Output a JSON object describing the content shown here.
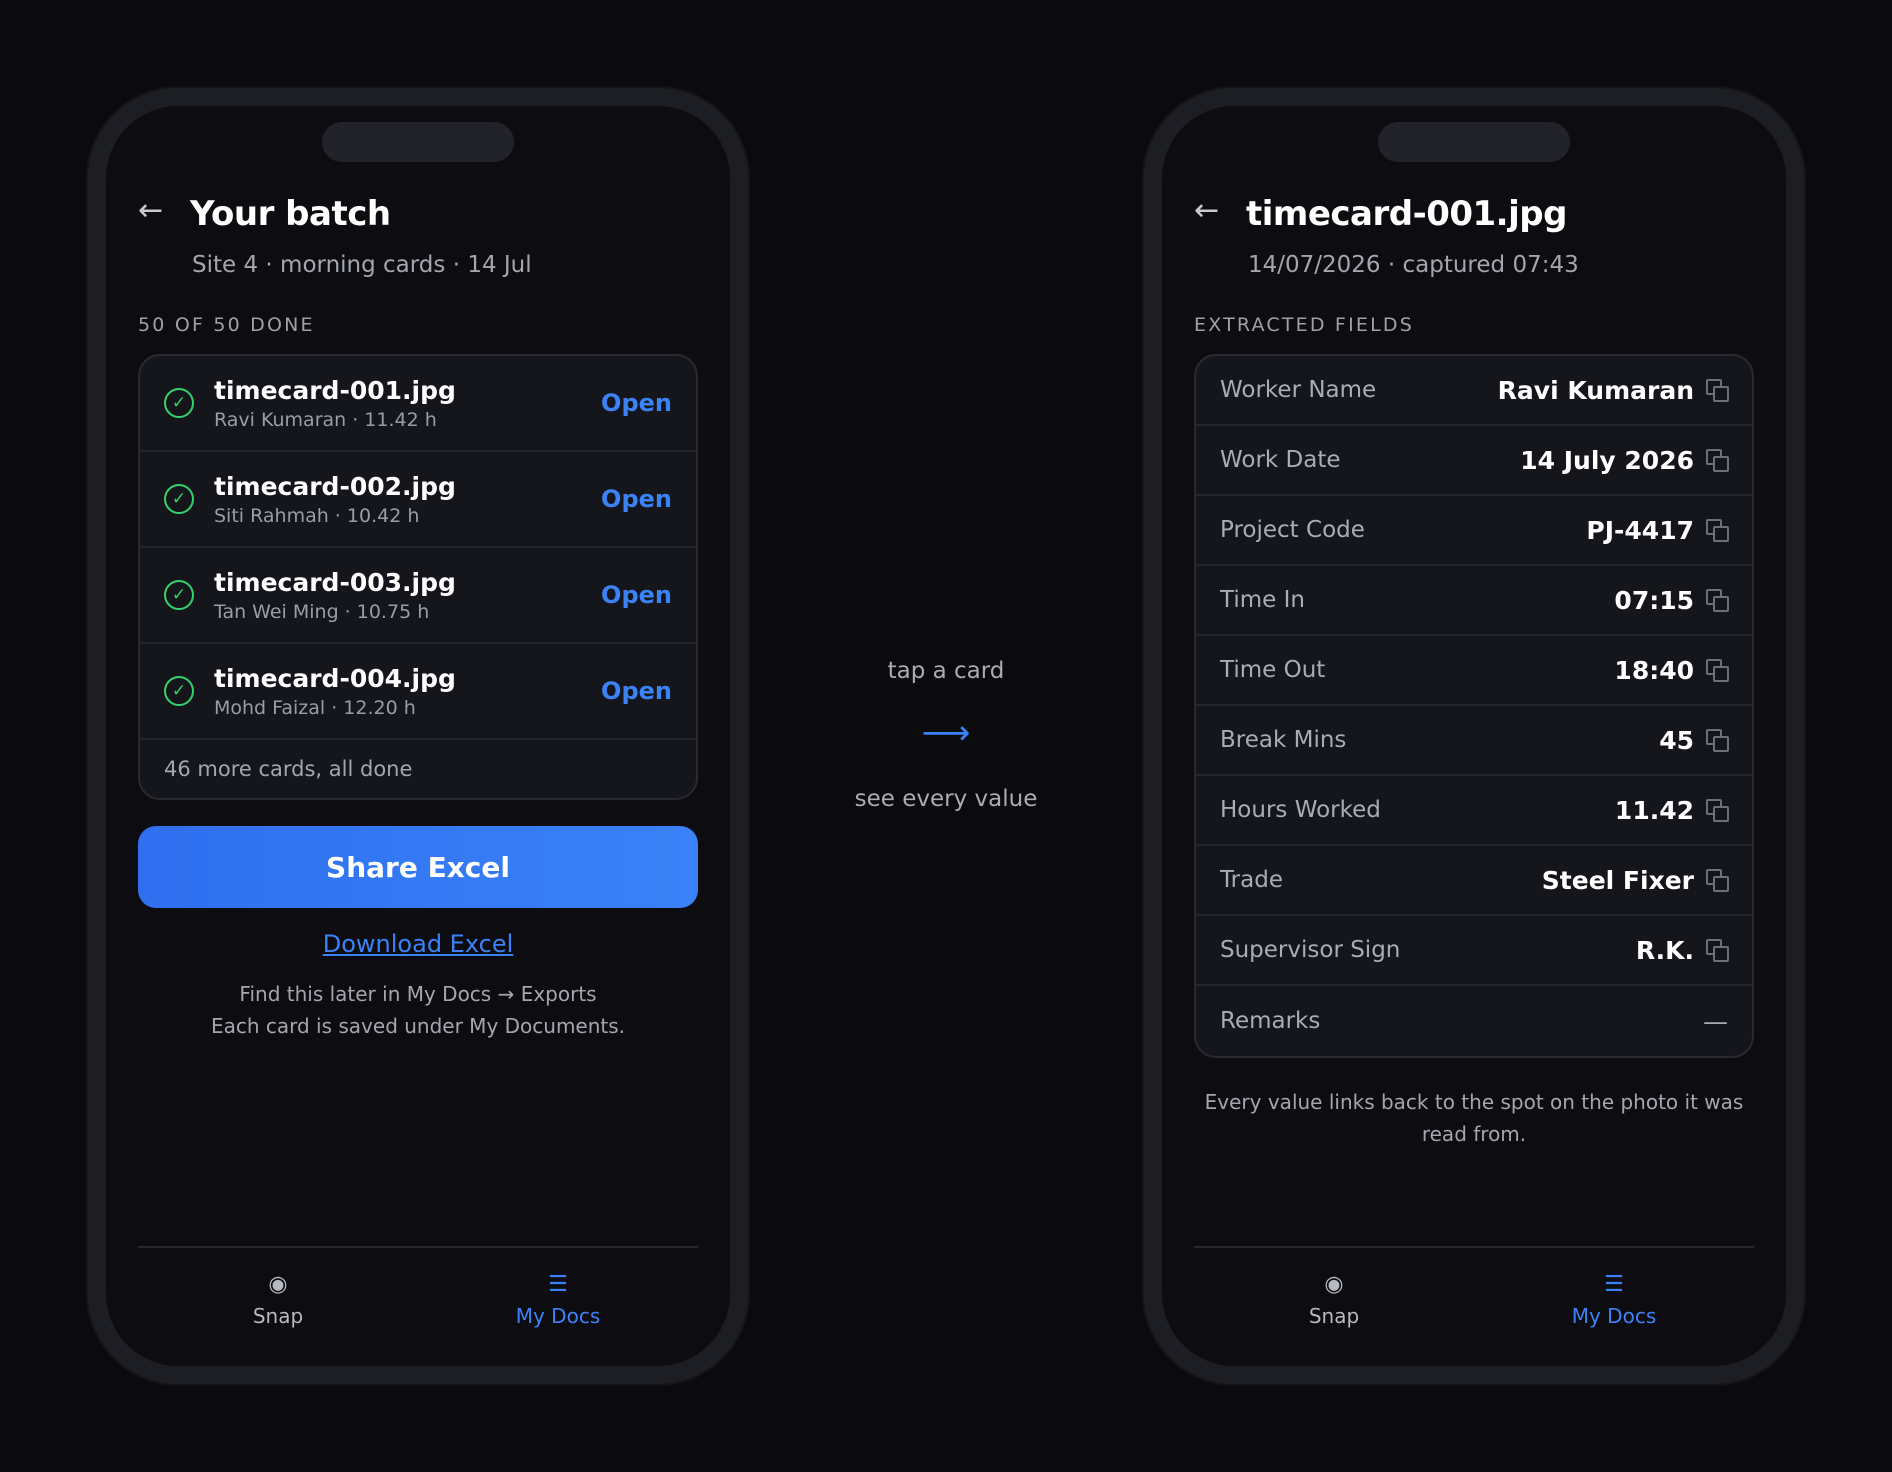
{
  "left": {
    "title": "Your batch",
    "subtitle": "Site 4 · morning cards · 14 Jul",
    "section_label": "50 OF 50 DONE",
    "files": [
      {
        "name": "timecard-001.jpg",
        "meta": "Ravi Kumaran · 11.42 h",
        "action": "Open"
      },
      {
        "name": "timecard-002.jpg",
        "meta": "Siti Rahmah · 10.42 h",
        "action": "Open"
      },
      {
        "name": "timecard-003.jpg",
        "meta": "Tan Wei Ming · 10.75 h",
        "action": "Open"
      },
      {
        "name": "timecard-004.jpg",
        "meta": "Mohd Faizal · 12.20 h",
        "action": "Open"
      }
    ],
    "more_text": "46 more cards, all done",
    "share_label": "Share Excel",
    "download_label": "Download Excel",
    "hint_line1": "Find this later in My Docs → Exports",
    "hint_line2": "Each card is saved under My Documents."
  },
  "middle": {
    "top_label": "tap a card",
    "bottom_label": "see every value"
  },
  "right": {
    "title": "timecard-001.jpg",
    "subtitle": "14/07/2026 · captured 07:43",
    "section_label": "EXTRACTED FIELDS",
    "fields": [
      {
        "label": "Worker Name",
        "value": "Ravi Kumaran"
      },
      {
        "label": "Work Date",
        "value": "14 July 2026"
      },
      {
        "label": "Project Code",
        "value": "PJ-4417"
      },
      {
        "label": "Time In",
        "value": "07:15"
      },
      {
        "label": "Time Out",
        "value": "18:40"
      },
      {
        "label": "Break Mins",
        "value": "45"
      },
      {
        "label": "Hours Worked",
        "value": "11.42"
      },
      {
        "label": "Trade",
        "value": "Steel Fixer"
      },
      {
        "label": "Supervisor Sign",
        "value": "R.K."
      },
      {
        "label": "Remarks",
        "value": "—"
      }
    ],
    "footnote": "Every value links back to the spot on the photo it was read from."
  },
  "tabbar": {
    "snap_label": "Snap",
    "docs_label": "My Docs",
    "snap_icon": "◉",
    "docs_icon": "☰"
  },
  "icons": {
    "back": "←",
    "check": "✓",
    "flow_arrow": "⟶"
  },
  "colors": {
    "background": "#0b0b0d",
    "accent": "#3b82f6",
    "success": "#34d36a"
  }
}
